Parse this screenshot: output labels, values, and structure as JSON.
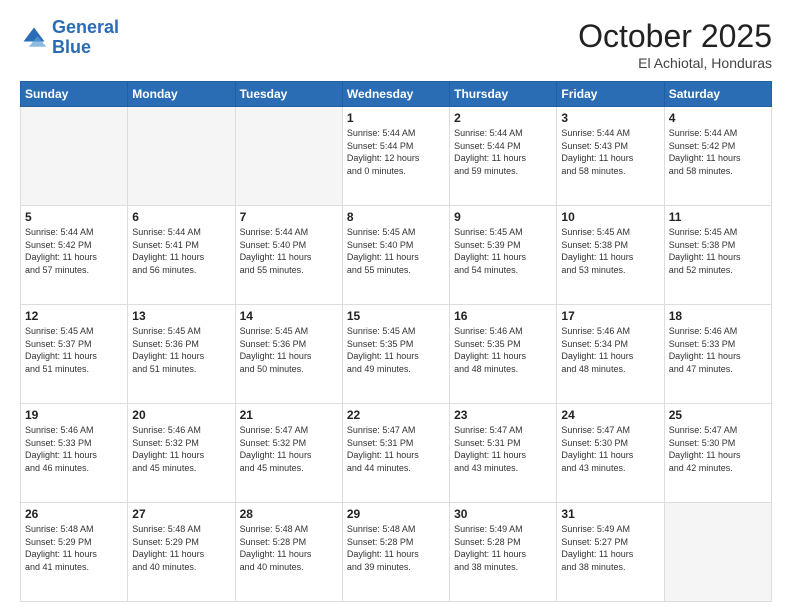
{
  "header": {
    "logo_line1": "General",
    "logo_line2": "Blue",
    "month": "October 2025",
    "location": "El Achiotal, Honduras"
  },
  "days_of_week": [
    "Sunday",
    "Monday",
    "Tuesday",
    "Wednesday",
    "Thursday",
    "Friday",
    "Saturday"
  ],
  "weeks": [
    [
      {
        "day": "",
        "info": ""
      },
      {
        "day": "",
        "info": ""
      },
      {
        "day": "",
        "info": ""
      },
      {
        "day": "1",
        "info": "Sunrise: 5:44 AM\nSunset: 5:44 PM\nDaylight: 12 hours\nand 0 minutes."
      },
      {
        "day": "2",
        "info": "Sunrise: 5:44 AM\nSunset: 5:44 PM\nDaylight: 11 hours\nand 59 minutes."
      },
      {
        "day": "3",
        "info": "Sunrise: 5:44 AM\nSunset: 5:43 PM\nDaylight: 11 hours\nand 58 minutes."
      },
      {
        "day": "4",
        "info": "Sunrise: 5:44 AM\nSunset: 5:42 PM\nDaylight: 11 hours\nand 58 minutes."
      }
    ],
    [
      {
        "day": "5",
        "info": "Sunrise: 5:44 AM\nSunset: 5:42 PM\nDaylight: 11 hours\nand 57 minutes."
      },
      {
        "day": "6",
        "info": "Sunrise: 5:44 AM\nSunset: 5:41 PM\nDaylight: 11 hours\nand 56 minutes."
      },
      {
        "day": "7",
        "info": "Sunrise: 5:44 AM\nSunset: 5:40 PM\nDaylight: 11 hours\nand 55 minutes."
      },
      {
        "day": "8",
        "info": "Sunrise: 5:45 AM\nSunset: 5:40 PM\nDaylight: 11 hours\nand 55 minutes."
      },
      {
        "day": "9",
        "info": "Sunrise: 5:45 AM\nSunset: 5:39 PM\nDaylight: 11 hours\nand 54 minutes."
      },
      {
        "day": "10",
        "info": "Sunrise: 5:45 AM\nSunset: 5:38 PM\nDaylight: 11 hours\nand 53 minutes."
      },
      {
        "day": "11",
        "info": "Sunrise: 5:45 AM\nSunset: 5:38 PM\nDaylight: 11 hours\nand 52 minutes."
      }
    ],
    [
      {
        "day": "12",
        "info": "Sunrise: 5:45 AM\nSunset: 5:37 PM\nDaylight: 11 hours\nand 51 minutes."
      },
      {
        "day": "13",
        "info": "Sunrise: 5:45 AM\nSunset: 5:36 PM\nDaylight: 11 hours\nand 51 minutes."
      },
      {
        "day": "14",
        "info": "Sunrise: 5:45 AM\nSunset: 5:36 PM\nDaylight: 11 hours\nand 50 minutes."
      },
      {
        "day": "15",
        "info": "Sunrise: 5:45 AM\nSunset: 5:35 PM\nDaylight: 11 hours\nand 49 minutes."
      },
      {
        "day": "16",
        "info": "Sunrise: 5:46 AM\nSunset: 5:35 PM\nDaylight: 11 hours\nand 48 minutes."
      },
      {
        "day": "17",
        "info": "Sunrise: 5:46 AM\nSunset: 5:34 PM\nDaylight: 11 hours\nand 48 minutes."
      },
      {
        "day": "18",
        "info": "Sunrise: 5:46 AM\nSunset: 5:33 PM\nDaylight: 11 hours\nand 47 minutes."
      }
    ],
    [
      {
        "day": "19",
        "info": "Sunrise: 5:46 AM\nSunset: 5:33 PM\nDaylight: 11 hours\nand 46 minutes."
      },
      {
        "day": "20",
        "info": "Sunrise: 5:46 AM\nSunset: 5:32 PM\nDaylight: 11 hours\nand 45 minutes."
      },
      {
        "day": "21",
        "info": "Sunrise: 5:47 AM\nSunset: 5:32 PM\nDaylight: 11 hours\nand 45 minutes."
      },
      {
        "day": "22",
        "info": "Sunrise: 5:47 AM\nSunset: 5:31 PM\nDaylight: 11 hours\nand 44 minutes."
      },
      {
        "day": "23",
        "info": "Sunrise: 5:47 AM\nSunset: 5:31 PM\nDaylight: 11 hours\nand 43 minutes."
      },
      {
        "day": "24",
        "info": "Sunrise: 5:47 AM\nSunset: 5:30 PM\nDaylight: 11 hours\nand 43 minutes."
      },
      {
        "day": "25",
        "info": "Sunrise: 5:47 AM\nSunset: 5:30 PM\nDaylight: 11 hours\nand 42 minutes."
      }
    ],
    [
      {
        "day": "26",
        "info": "Sunrise: 5:48 AM\nSunset: 5:29 PM\nDaylight: 11 hours\nand 41 minutes."
      },
      {
        "day": "27",
        "info": "Sunrise: 5:48 AM\nSunset: 5:29 PM\nDaylight: 11 hours\nand 40 minutes."
      },
      {
        "day": "28",
        "info": "Sunrise: 5:48 AM\nSunset: 5:28 PM\nDaylight: 11 hours\nand 40 minutes."
      },
      {
        "day": "29",
        "info": "Sunrise: 5:48 AM\nSunset: 5:28 PM\nDaylight: 11 hours\nand 39 minutes."
      },
      {
        "day": "30",
        "info": "Sunrise: 5:49 AM\nSunset: 5:28 PM\nDaylight: 11 hours\nand 38 minutes."
      },
      {
        "day": "31",
        "info": "Sunrise: 5:49 AM\nSunset: 5:27 PM\nDaylight: 11 hours\nand 38 minutes."
      },
      {
        "day": "",
        "info": ""
      }
    ]
  ]
}
